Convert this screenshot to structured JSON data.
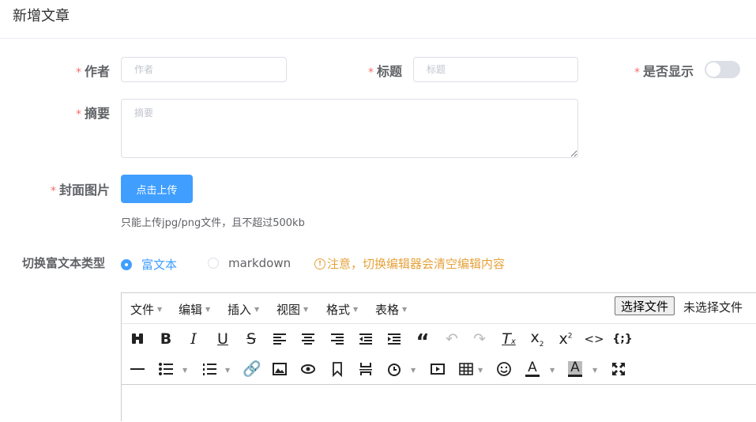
{
  "header": {
    "title": "新增文章"
  },
  "form": {
    "required_mark": "*",
    "author": {
      "label": "作者",
      "placeholder": "作者",
      "value": ""
    },
    "title": {
      "label": "标题",
      "placeholder": "标题",
      "value": ""
    },
    "visible": {
      "label": "是否显示",
      "enabled": false
    },
    "summary": {
      "label": "摘要",
      "placeholder": "摘要",
      "value": ""
    },
    "cover": {
      "label": "封面图片",
      "button": "点击上传",
      "tip": "只能上传jpg/png文件，且不超过500kb"
    },
    "editor_type": {
      "label": "切换富文本类型",
      "options": [
        "富文本",
        "markdown"
      ],
      "selected": "富文本",
      "warning": "注意，切换编辑器会清空编辑内容"
    }
  },
  "editor": {
    "menus": [
      "文件",
      "编辑",
      "插入",
      "视图",
      "格式",
      "表格"
    ],
    "file_button": "选择文件",
    "file_status": "未选择文件",
    "toolbar_row1": [
      "find-replace-icon",
      "bold-icon",
      "italic-icon",
      "underline-icon",
      "strikethrough-icon",
      "align-left-icon",
      "align-center-icon",
      "align-right-icon",
      "outdent-icon",
      "indent-icon",
      "blockquote-icon",
      "undo-icon",
      "redo-icon",
      "clear-format-icon",
      "subscript-icon",
      "superscript-icon",
      "code-icon",
      "code-sample-icon"
    ],
    "toolbar_row2": [
      "horizontal-rule-icon",
      "bullet-list-icon",
      "numbered-list-icon",
      "link-icon",
      "image-icon",
      "preview-icon",
      "bookmark-icon",
      "page-break-icon",
      "insert-datetime-icon",
      "media-icon",
      "table-icon",
      "emoticon-icon",
      "text-color-icon",
      "background-color-icon",
      "fullscreen-icon"
    ],
    "text_color_letter": "A"
  },
  "colors": {
    "primary": "#409eff",
    "warning": "#e6a23c",
    "required": "#f56c6c"
  }
}
